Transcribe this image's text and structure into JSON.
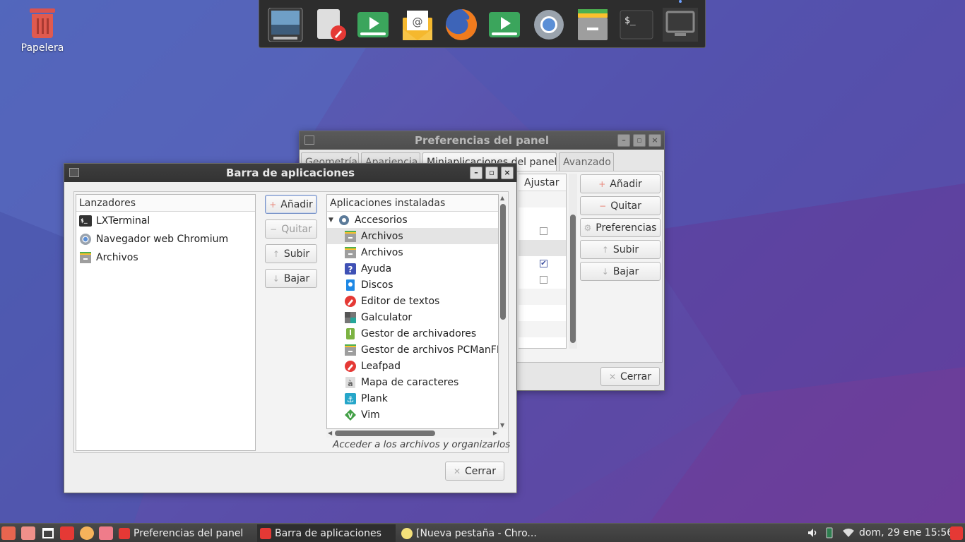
{
  "desktop": {
    "trash_label": "Papelera"
  },
  "dock": {
    "items": [
      "image-viewer-icon",
      "text-editor-icon",
      "media-player-icon",
      "mail-icon",
      "firefox-icon",
      "media-player-icon",
      "chromium-icon",
      "file-manager-icon",
      "terminal-icon",
      "display-icon"
    ]
  },
  "prefs_window": {
    "title": "Preferencias del panel",
    "tabs": [
      "Geometría",
      "Apariencia",
      "Miniaplicaciones del panel",
      "Avanzado"
    ],
    "active_tab": "Miniaplicaciones del panel",
    "column_header": "Ajustar",
    "checkboxes": [
      false,
      true,
      false
    ],
    "buttons": {
      "add": "Añadir",
      "remove": "Quitar",
      "preferences": "Preferencias",
      "up": "Subir",
      "down": "Bajar",
      "close": "Cerrar"
    }
  },
  "launcher_window": {
    "title": "Barra de aplicaciones",
    "left_header": "Lanzadores",
    "launchers": [
      {
        "label": "LXTerminal",
        "icon": "terminal-icon"
      },
      {
        "label": "Navegador web Chromium",
        "icon": "chromium-icon"
      },
      {
        "label": "Archivos",
        "icon": "file-manager-icon"
      }
    ],
    "buttons": {
      "add": "Añadir",
      "remove": "Quitar",
      "up": "Subir",
      "down": "Bajar",
      "close": "Cerrar"
    },
    "right_header": "Aplicaciones instaladas",
    "category": "Accesorios",
    "apps": [
      {
        "label": "Archivos",
        "icon": "file-manager-icon",
        "selected": true
      },
      {
        "label": "Archivos",
        "icon": "file-manager-icon"
      },
      {
        "label": "Ayuda",
        "icon": "help-icon"
      },
      {
        "label": "Discos",
        "icon": "disks-icon"
      },
      {
        "label": "Editor de textos",
        "icon": "text-editor-icon"
      },
      {
        "label": "Galculator",
        "icon": "calculator-icon"
      },
      {
        "label": "Gestor de archivadores",
        "icon": "archive-icon"
      },
      {
        "label": "Gestor de archivos PCManFM",
        "icon": "file-manager-icon"
      },
      {
        "label": "Leafpad",
        "icon": "text-editor-icon"
      },
      {
        "label": "Mapa de caracteres",
        "icon": "charmap-icon"
      },
      {
        "label": "Plank",
        "icon": "plank-icon"
      },
      {
        "label": "Vim",
        "icon": "vim-icon"
      }
    ],
    "description": "Acceder a los archivos y organizarlos"
  },
  "taskbar": {
    "tasks": [
      {
        "label": "Preferencias del panel",
        "active": false
      },
      {
        "label": "Barra de aplicaciones",
        "active": true
      },
      {
        "label": "[Nueva pestaña - Chro...",
        "active": false
      }
    ],
    "clock": "dom, 29 ene 15:56"
  },
  "colors": {
    "accent_red": "#e53935",
    "panel_dark": "#3b3b3b",
    "selection": "#e4e4e4"
  }
}
